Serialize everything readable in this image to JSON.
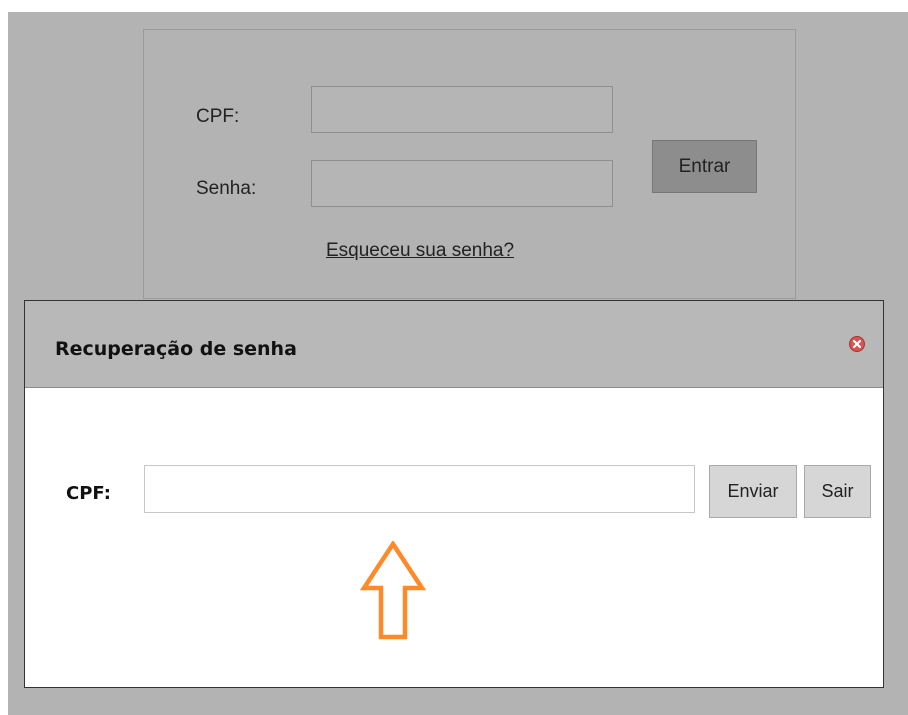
{
  "login": {
    "cpf_label": "CPF:",
    "password_label": "Senha:",
    "enter_button": "Entrar",
    "forgot_link": "Esqueceu sua senha?",
    "cpf_value": "",
    "password_value": ""
  },
  "modal": {
    "title": "Recuperação de senha",
    "cpf_label": "CPF:",
    "cpf_value": "",
    "send_button": "Enviar",
    "exit_button": "Sair",
    "close_icon": "close-circle-icon",
    "annotation_icon": "up-arrow-icon"
  },
  "colors": {
    "overlay": "#b3b3b3",
    "modal_header": "#b8b8b8",
    "close_icon": "#d9534f",
    "arrow": "#ff8a2a"
  }
}
